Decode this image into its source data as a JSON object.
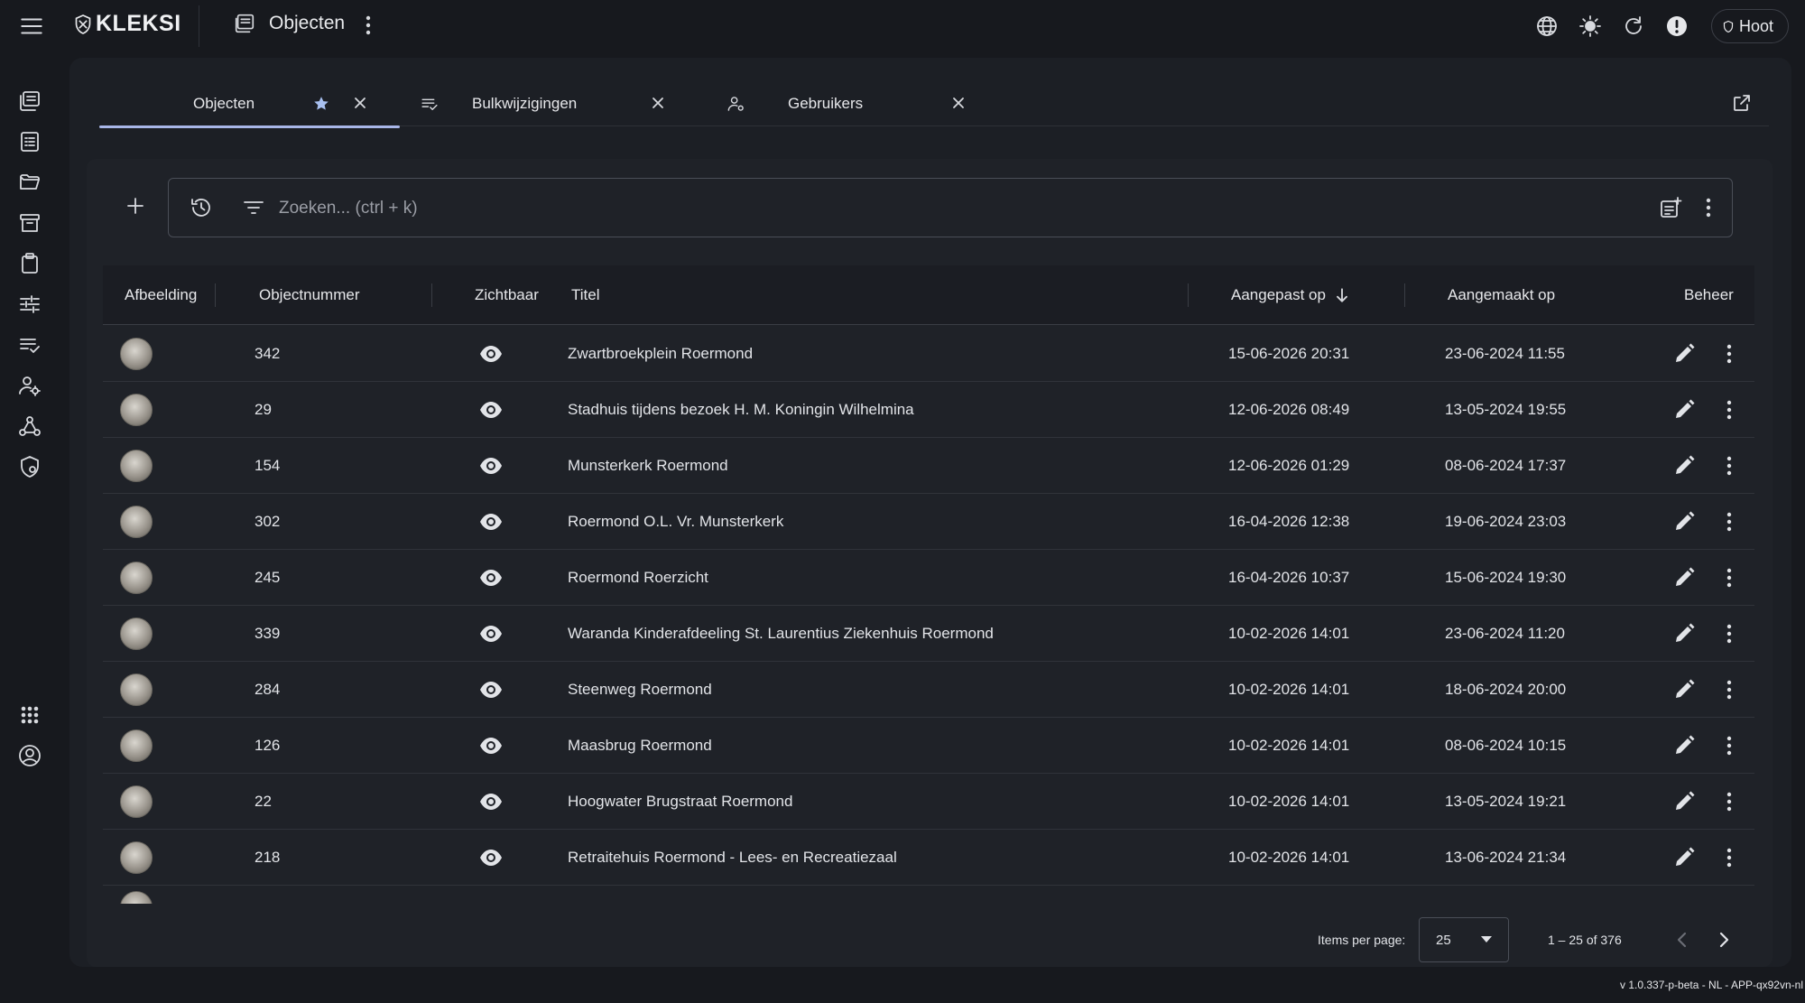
{
  "app": {
    "logo_text": "KLEKSI",
    "title": "Objecten",
    "user_label": "Hoot",
    "version": "v 1.0.337-p-beta - NL - APP-qx92vn-nl"
  },
  "tabs": [
    {
      "label": "Objecten",
      "icon": "star-icon"
    },
    {
      "label": "Bulkwijzigingen",
      "icon": "playlist-check-icon"
    },
    {
      "label": "Gebruikers",
      "icon": "user-gear-icon"
    }
  ],
  "search": {
    "placeholder": "Zoeken... (ctrl + k)"
  },
  "table": {
    "columns": {
      "image": "Afbeelding",
      "number": "Objectnummer",
      "visible": "Zichtbaar",
      "title": "Titel",
      "modified": "Aangepast op",
      "created": "Aangemaakt op",
      "actions": "Beheer"
    },
    "rows": [
      {
        "number": "342",
        "title": "Zwartbroekplein Roermond",
        "modified": "15-06-2026 20:31",
        "created": "23-06-2024 11:55"
      },
      {
        "number": "29",
        "title": "Stadhuis tijdens bezoek H. M. Koningin Wilhelmina",
        "modified": "12-06-2026 08:49",
        "created": "13-05-2024 19:55"
      },
      {
        "number": "154",
        "title": "Munsterkerk Roermond",
        "modified": "12-06-2026 01:29",
        "created": "08-06-2024 17:37"
      },
      {
        "number": "302",
        "title": "Roermond O.L. Vr. Munsterkerk",
        "modified": "16-04-2026 12:38",
        "created": "19-06-2024 23:03"
      },
      {
        "number": "245",
        "title": "Roermond Roerzicht",
        "modified": "16-04-2026 10:37",
        "created": "15-06-2024 19:30"
      },
      {
        "number": "339",
        "title": "Waranda Kinderafdeeling St. Laurentius Ziekenhuis Roermond",
        "modified": "10-02-2026 14:01",
        "created": "23-06-2024 11:20"
      },
      {
        "number": "284",
        "title": "Steenweg Roermond",
        "modified": "10-02-2026 14:01",
        "created": "18-06-2024 20:00"
      },
      {
        "number": "126",
        "title": "Maasbrug Roermond",
        "modified": "10-02-2026 14:01",
        "created": "08-06-2024 10:15"
      },
      {
        "number": "22",
        "title": "Hoogwater Brugstraat Roermond",
        "modified": "10-02-2026 14:01",
        "created": "13-05-2024 19:21"
      },
      {
        "number": "218",
        "title": "Retraitehuis Roermond - Lees- en Recreatiezaal",
        "modified": "10-02-2026 14:01",
        "created": "13-06-2024 21:34"
      }
    ]
  },
  "paginator": {
    "items_per_page_label": "Items per page:",
    "items_per_page_value": "25",
    "range_label": "1 – 25 of 376"
  }
}
